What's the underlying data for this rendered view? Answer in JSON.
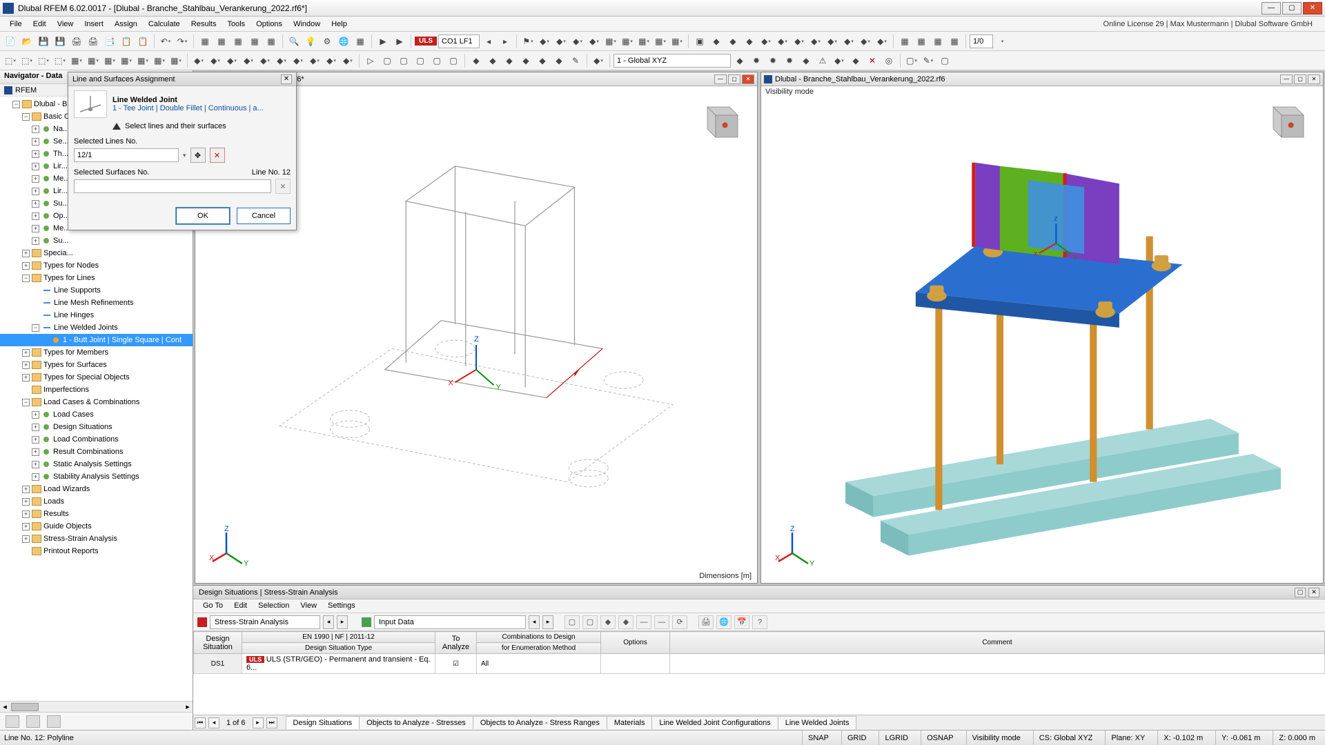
{
  "title": "Dlubal RFEM 6.02.0017 - [Dlubal - Branche_Stahlbau_Verankerung_2022.rf6*]",
  "license": "Online License 29 | Max Mustermann | Dlubal Software GmbH",
  "menu": [
    "File",
    "Edit",
    "View",
    "Insert",
    "Assign",
    "Calculate",
    "Results",
    "Tools",
    "Options",
    "Window",
    "Help"
  ],
  "tb1": {
    "uls": "ULS",
    "co": "CO1",
    "lf": "LF1",
    "sup": "1/0"
  },
  "tb2": {
    "combo": "1 - Global XYZ"
  },
  "navigator": {
    "title": "Navigator - Data",
    "root": "RFEM",
    "model": "Dlubal - B...",
    "basic": "Basic O...",
    "clipped": [
      "Na...",
      "Se...",
      "Th...",
      "Lir...",
      "Me...",
      "Lir...",
      "Su...",
      "Op...",
      "Me...",
      "Su..."
    ],
    "special": "Specia...",
    "types_nodes": "Types for Nodes",
    "types_lines": "Types for Lines",
    "line_supports": "Line Supports",
    "line_mesh": "Line Mesh Refinements",
    "line_hinges": "Line Hinges",
    "line_welded": "Line Welded Joints",
    "lw_item": "1 - Butt Joint | Single Square | Cont",
    "types_members": "Types for Members",
    "types_surfaces": "Types for Surfaces",
    "types_special": "Types for Special Objects",
    "imperfections": "Imperfections",
    "lcc": "Load Cases & Combinations",
    "load_cases": "Load Cases",
    "design_sit": "Design Situations",
    "load_comb": "Load Combinations",
    "result_comb": "Result Combinations",
    "static_ana": "Static Analysis Settings",
    "stability": "Stability Analysis Settings",
    "load_wizards": "Load Wizards",
    "loads": "Loads",
    "results": "Results",
    "guide": "Guide Objects",
    "ssa": "Stress-Strain Analysis",
    "printout": "Printout Reports"
  },
  "views": {
    "left_title": "bau_Verankerung_2022.rf6*",
    "right_title": "Dlubal - Branche_Stahlbau_Verankerung_2022.rf6",
    "dim": "Dimensions [m]",
    "vis": "Visibility mode"
  },
  "dialog": {
    "title": "Line and Surfaces Assignment",
    "joint_name": "Line Welded Joint",
    "joint_link": "1 - Tee Joint | Double Fillet | Continuous | a...",
    "select_hint": "Select lines and their surfaces",
    "sel_lines_label": "Selected Lines No.",
    "sel_lines_val": "12/1",
    "sel_surf_label": "Selected Surfaces No.",
    "line_no": "Line No. 12",
    "ok": "OK",
    "cancel": "Cancel"
  },
  "bottom": {
    "title": "Design Situations | Stress-Strain Analysis",
    "menu": [
      "Go To",
      "Edit",
      "Selection",
      "View",
      "Settings"
    ],
    "combo1": "Stress-Strain Analysis",
    "combo2": "Input Data",
    "headers": {
      "ds": "Design\nSituation",
      "dst_sup": "EN 1990 | NF | 2011-12",
      "dst": "Design Situation Type",
      "ta": "To\nAnalyze",
      "ctd_sup": "Combinations to Design",
      "ctd": "for Enumeration Method",
      "opt": "Options",
      "comment": "Comment"
    },
    "row": {
      "ds": "DS1",
      "uls": "ULS",
      "dst": "ULS (STR/GEO) - Permanent and transient - Eq. 6...",
      "all": "All"
    },
    "page": "1 of 6",
    "tabs": [
      "Design Situations",
      "Objects to Analyze - Stresses",
      "Objects to Analyze - Stress Ranges",
      "Materials",
      "Line Welded Joint Configurations",
      "Line Welded Joints"
    ]
  },
  "status": {
    "left": "Line No. 12: Polyline",
    "snap": "SNAP",
    "grid": "GRID",
    "lgrid": "LGRID",
    "osnap": "OSNAP",
    "vis": "Visibility mode",
    "cs": "CS: Global XYZ",
    "plane": "Plane: XY",
    "x": "X: -0.102 m",
    "y": "Y: -0.061 m",
    "z": "Z: 0.000 m"
  }
}
